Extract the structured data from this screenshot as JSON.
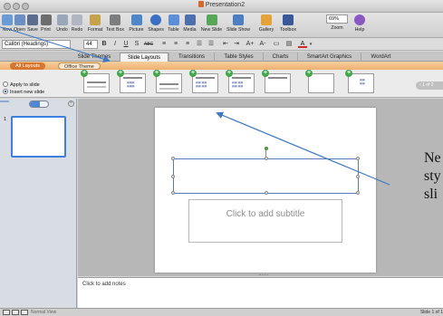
{
  "window": {
    "title": "Presentation2"
  },
  "toolbar": [
    {
      "name": "new",
      "label": "New",
      "color": "#6a9bd6"
    },
    {
      "name": "open",
      "label": "Open",
      "color": "#6b8fc2"
    },
    {
      "name": "save",
      "label": "Save",
      "color": "#5a6d8e"
    },
    {
      "name": "print",
      "label": "Print",
      "color": "#6d6d6d"
    },
    {
      "name": "undo",
      "label": "Undo",
      "color": "#9aa7bb"
    },
    {
      "name": "redo",
      "label": "Redo",
      "color": "#b0b7c3"
    },
    {
      "name": "format",
      "label": "Format",
      "color": "#c6a24a"
    },
    {
      "name": "text-box",
      "label": "Text Box",
      "color": "#7d7d7d"
    },
    {
      "name": "picture",
      "label": "Picture",
      "color": "#4f86c9"
    },
    {
      "name": "shapes",
      "label": "Shapes",
      "color": "#3b6fc1"
    },
    {
      "name": "table",
      "label": "Table",
      "color": "#5d8ed8"
    },
    {
      "name": "media",
      "label": "Media",
      "color": "#4c6fae"
    },
    {
      "name": "new-slide",
      "label": "New Slide",
      "color": "#57a65a"
    },
    {
      "name": "slide-show",
      "label": "Slide Show",
      "color": "#4d7ec2"
    },
    {
      "name": "gallery",
      "label": "Gallery",
      "color": "#e3a23a"
    },
    {
      "name": "toolbox",
      "label": "Toolbox",
      "color": "#3b5998"
    },
    {
      "name": "zoom",
      "label": "Zoom",
      "value": "69%"
    },
    {
      "name": "help",
      "label": "Help",
      "color": "#8a58c0"
    }
  ],
  "format_bar": {
    "font": "Calibri (Headings)",
    "size": "44",
    "bold": "B",
    "italic": "I",
    "underline": "U",
    "shadow": "S",
    "strike": "ABC",
    "grow": "A+",
    "shrink": "A-",
    "color": "A"
  },
  "tabs": [
    {
      "label": "Slide Themes",
      "active": false
    },
    {
      "label": "Slide Layouts",
      "active": true
    },
    {
      "label": "Transitions",
      "active": false
    },
    {
      "label": "Table Styles",
      "active": false
    },
    {
      "label": "Charts",
      "active": false
    },
    {
      "label": "SmartArt Graphics",
      "active": false
    },
    {
      "label": "WordArt",
      "active": false
    }
  ],
  "ribbon": {
    "layout_buttons": [
      "All Layouts",
      "Office Theme"
    ],
    "options": [
      {
        "label": "Apply to slide",
        "selected": false
      },
      {
        "label": "Insert new slide",
        "selected": true
      }
    ],
    "pager": "1 of 2"
  },
  "sidebar": {
    "slide_number": "1"
  },
  "slide": {
    "subtitle_placeholder": "Click to add subtitle"
  },
  "annotation": {
    "lines": [
      "Ne",
      "sty",
      "sli"
    ]
  },
  "notes": {
    "placeholder": "Click to add notes"
  },
  "status": {
    "view": "Normal View",
    "slide_info": "Slide 1 of 1"
  },
  "colors": {
    "accent": "#d7772f",
    "selection": "#3e7fe0",
    "arrow": "#3f79c4"
  }
}
